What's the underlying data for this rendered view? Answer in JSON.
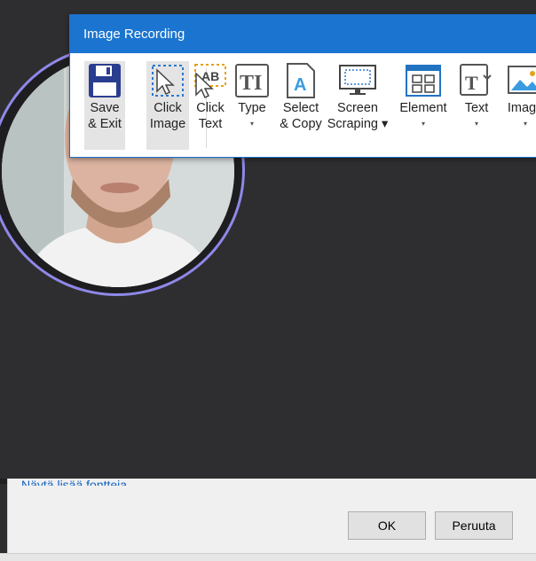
{
  "recorder": {
    "title": "Image Recording",
    "tools": [
      {
        "label": "Save\n& Exit"
      },
      {
        "label": "Click\nImage"
      },
      {
        "label": "Click\nText"
      },
      {
        "label": "Type",
        "caret": "▾"
      },
      {
        "label": "Select\n& Copy"
      },
      {
        "label": "Screen\nScraping ▾"
      },
      {
        "label": "Element",
        "caret": "▾"
      },
      {
        "label": "Text",
        "caret": "▾"
      },
      {
        "label": "Image",
        "caret": "▾"
      }
    ]
  },
  "dialog": {
    "link_text": "Näytä lisää fontteja",
    "ok_label": "OK",
    "cancel_label": "Peruuta"
  }
}
